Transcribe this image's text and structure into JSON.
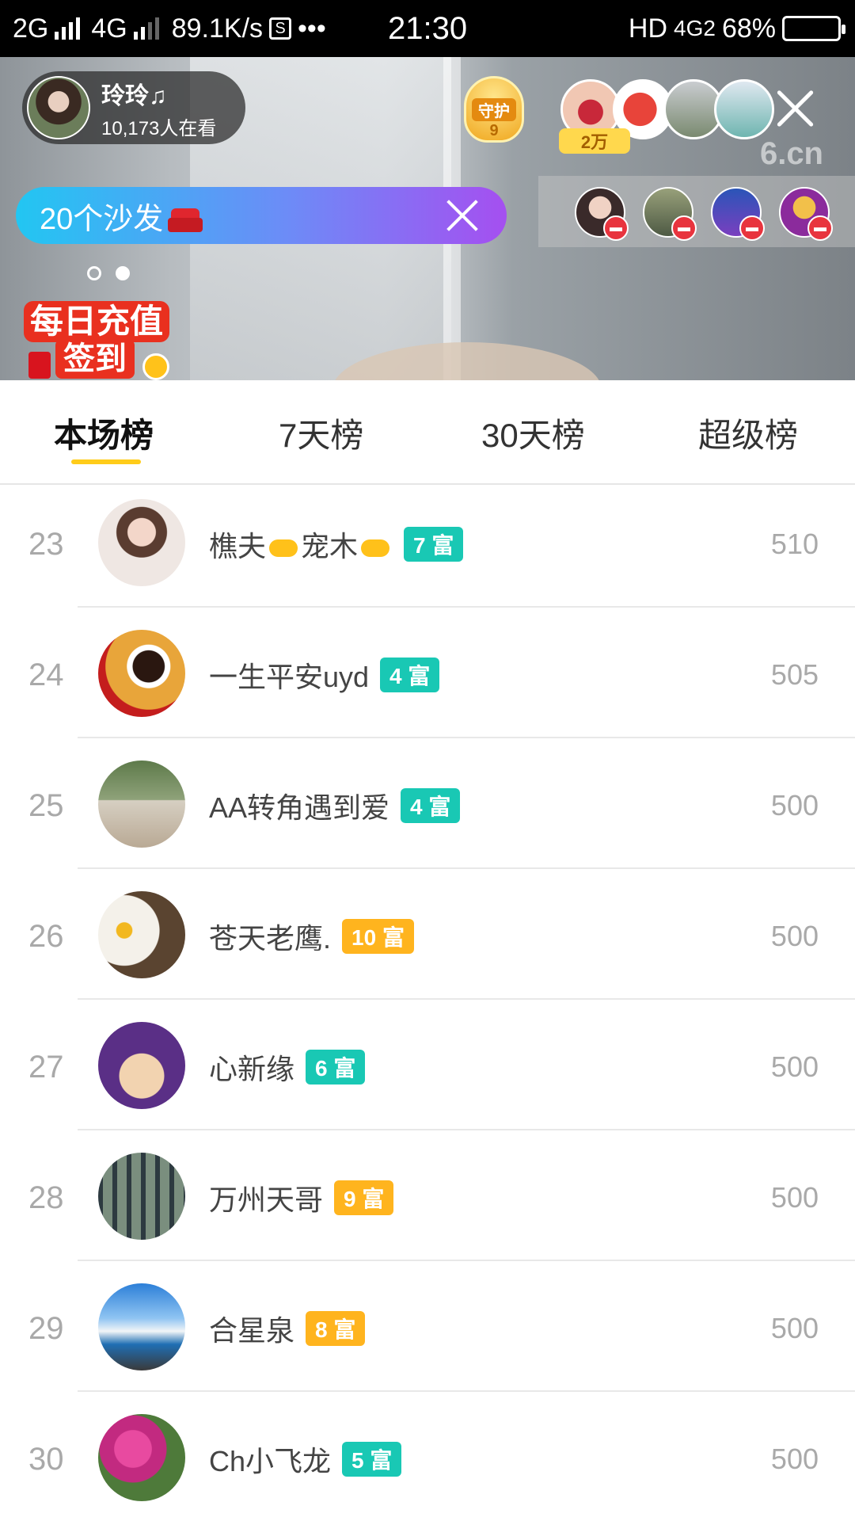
{
  "status_bar": {
    "network_left": "2G",
    "network_mid": "4G",
    "speed": "89.1K/s",
    "s_icon_label": "S",
    "more": "•••",
    "time": "21:30",
    "hd": "HD",
    "network_right": "4G2",
    "battery": "68%"
  },
  "header": {
    "host_name": "玲玲♫",
    "viewers": "10,173人在看",
    "guard_label": "守护",
    "guard_count": "9",
    "fan_badge": "2万",
    "watermark": "6.cn",
    "banner_text": "20个沙发",
    "promo_line1": "每日充值",
    "promo_line2": "签到"
  },
  "tabs": [
    {
      "label": "本场榜",
      "active": true
    },
    {
      "label": "7天榜",
      "active": false
    },
    {
      "label": "30天榜",
      "active": false
    },
    {
      "label": "超级榜",
      "active": false
    }
  ],
  "ranking": [
    {
      "rank": "23",
      "name_a": "樵夫",
      "name_b": "宠木",
      "level": "7 富",
      "level_color": "#19c8b4",
      "score": "510",
      "avatar": "woman-portrait"
    },
    {
      "rank": "24",
      "name": "一生平安uyd",
      "level": "4 富",
      "level_color": "#19c8b4",
      "score": "505",
      "avatar": "coffee-rose"
    },
    {
      "rank": "25",
      "name": "AA转角遇到爱",
      "level": "4 富",
      "level_color": "#19c8b4",
      "score": "500",
      "avatar": "children-photo"
    },
    {
      "rank": "26",
      "name": "苍天老鹰.",
      "level": "10 富",
      "level_color": "#ffb41e",
      "score": "500",
      "avatar": "eagle"
    },
    {
      "rank": "27",
      "name": "心新缘",
      "level": "6 富",
      "level_color": "#19c8b4",
      "score": "500",
      "avatar": "cartoon-face"
    },
    {
      "rank": "28",
      "name": "万州天哥",
      "level": "9 富",
      "level_color": "#ffb41e",
      "score": "500",
      "avatar": "fence-garden"
    },
    {
      "rank": "29",
      "name": "合星泉",
      "level": "8 富",
      "level_color": "#ffb41e",
      "score": "500",
      "avatar": "beach-sky"
    },
    {
      "rank": "30",
      "name": "Ch小飞龙",
      "level": "5 富",
      "level_color": "#19c8b4",
      "score": "500",
      "avatar": "pink-flowers"
    }
  ]
}
